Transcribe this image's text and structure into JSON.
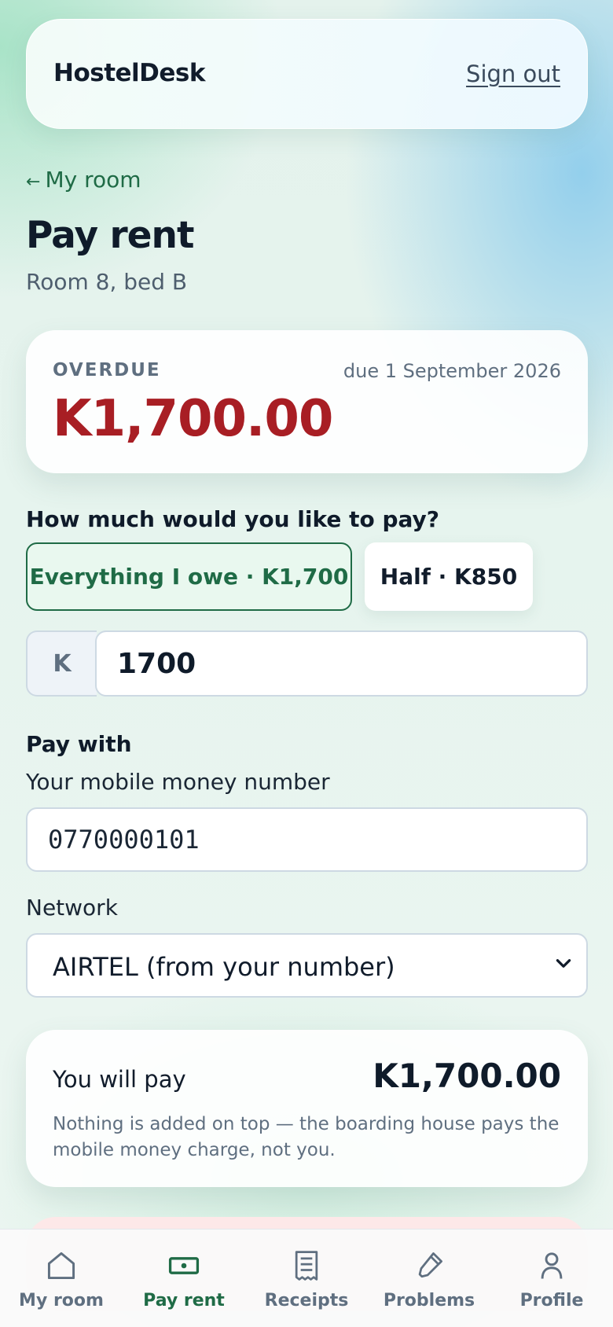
{
  "header": {
    "brand": "HostelDesk",
    "sign_out": "Sign out"
  },
  "back_link": {
    "arrow": "←",
    "label": "My room"
  },
  "page": {
    "title": "Pay rent",
    "subtitle": "Room 8, bed B"
  },
  "due": {
    "status": "OVERDUE",
    "date": "due 1 September 2026",
    "amount": "K1,700.00"
  },
  "amount_section": {
    "question": "How much would you like to pay?",
    "options": [
      {
        "label": "Everything I owe · K1,700",
        "selected": true
      },
      {
        "label": "Half · K850",
        "selected": false
      }
    ],
    "currency_prefix": "K",
    "value": "1700"
  },
  "payment": {
    "heading": "Pay with",
    "number_label": "Your mobile money number",
    "number_value": "0770000101",
    "network_label": "Network",
    "network_value": "AIRTEL (from your number)"
  },
  "summary": {
    "label": "You will pay",
    "amount": "K1,700.00",
    "note": "Nothing is added on top — the boarding house pays the mobile money charge, not you."
  },
  "bottom_nav": {
    "active": "Pay rent",
    "items": [
      {
        "label": "My room",
        "icon": "home-icon"
      },
      {
        "label": "Pay rent",
        "icon": "banknote-icon"
      },
      {
        "label": "Receipts",
        "icon": "receipt-icon"
      },
      {
        "label": "Problems",
        "icon": "brush-icon"
      },
      {
        "label": "Profile",
        "icon": "user-icon"
      }
    ]
  },
  "colors": {
    "accent": "#1f6b46",
    "overdue": "#a81e24",
    "text": "#0f1b2a",
    "muted": "#5f6f80"
  }
}
